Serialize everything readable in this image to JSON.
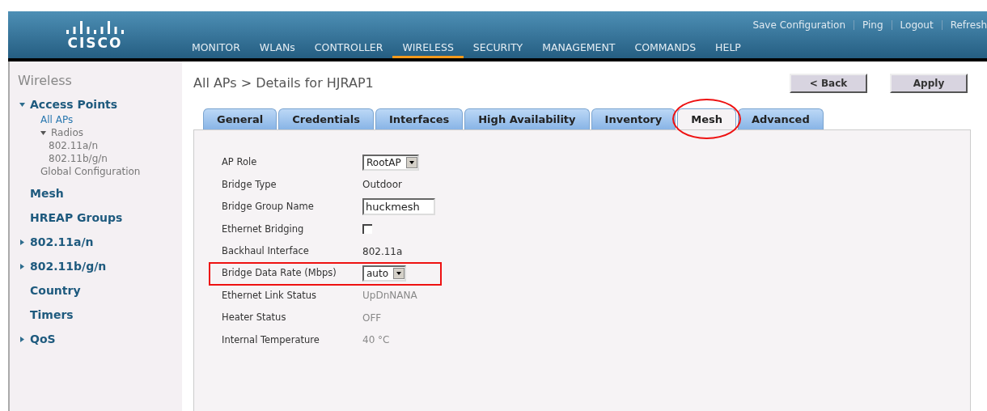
{
  "header": {
    "logo": "CISCO",
    "links": [
      "Save Configuration",
      "Ping",
      "Logout",
      "Refresh"
    ],
    "menu": [
      {
        "label": "MONITOR",
        "selected": false
      },
      {
        "label": "WLANs",
        "selected": false
      },
      {
        "label": "CONTROLLER",
        "selected": false
      },
      {
        "label": "WIRELESS",
        "selected": true
      },
      {
        "label": "SECURITY",
        "selected": false
      },
      {
        "label": "MANAGEMENT",
        "selected": false
      },
      {
        "label": "COMMANDS",
        "selected": false
      },
      {
        "label": "HELP",
        "selected": false
      }
    ]
  },
  "sidebar": {
    "title": "Wireless",
    "items": [
      {
        "label": "Access Points",
        "expanded": true,
        "children": [
          {
            "label": "All APs",
            "selected": true
          },
          {
            "label": "Radios",
            "expanded": true,
            "children": [
              {
                "label": "802.11a/n",
                "selected": false
              },
              {
                "label": "802.11b/g/n",
                "selected": false
              }
            ]
          },
          {
            "label": "Global Configuration",
            "selected": false
          }
        ]
      },
      {
        "label": "Mesh"
      },
      {
        "label": "HREAP Groups"
      },
      {
        "label": "802.11a/n",
        "expanded": false
      },
      {
        "label": "802.11b/g/n",
        "expanded": false
      },
      {
        "label": "Country"
      },
      {
        "label": "Timers"
      },
      {
        "label": "QoS",
        "expanded": false
      }
    ]
  },
  "page": {
    "title": "All APs > Details for HJRAP1",
    "buttons": [
      "< Back",
      "Apply"
    ]
  },
  "tabs": [
    {
      "label": "General",
      "selected": false,
      "highlighted": false
    },
    {
      "label": "Credentials",
      "selected": false,
      "highlighted": false
    },
    {
      "label": "Interfaces",
      "selected": false,
      "highlighted": false
    },
    {
      "label": "High Availability",
      "selected": false,
      "highlighted": false
    },
    {
      "label": "Inventory",
      "selected": false,
      "highlighted": false
    },
    {
      "label": "Mesh",
      "selected": true,
      "highlighted": true
    },
    {
      "label": "Advanced",
      "selected": false,
      "highlighted": false
    }
  ],
  "fields": [
    {
      "label": "AP Role",
      "kind": "select",
      "value": "RootAP",
      "highlighted": false
    },
    {
      "label": "Bridge Type",
      "kind": "text",
      "value": "Outdoor",
      "highlighted": false
    },
    {
      "label": "Bridge Group Name",
      "kind": "input",
      "value": "huckmesh",
      "highlighted": false
    },
    {
      "label": "Ethernet Bridging",
      "kind": "checkbox",
      "checked": false,
      "highlighted": false
    },
    {
      "label": "Backhaul Interface",
      "kind": "text",
      "value": "802.11a",
      "highlighted": false
    },
    {
      "label": "Bridge Data Rate (Mbps)",
      "kind": "select",
      "value": "auto",
      "highlighted": true
    },
    {
      "label": "Ethernet Link Status",
      "kind": "status",
      "value": "UpDnNANA",
      "highlighted": false
    },
    {
      "label": "Heater Status",
      "kind": "status",
      "value": "OFF",
      "highlighted": false
    },
    {
      "label": "Internal Temperature",
      "kind": "status",
      "value": "40 °C",
      "highlighted": false
    }
  ]
}
